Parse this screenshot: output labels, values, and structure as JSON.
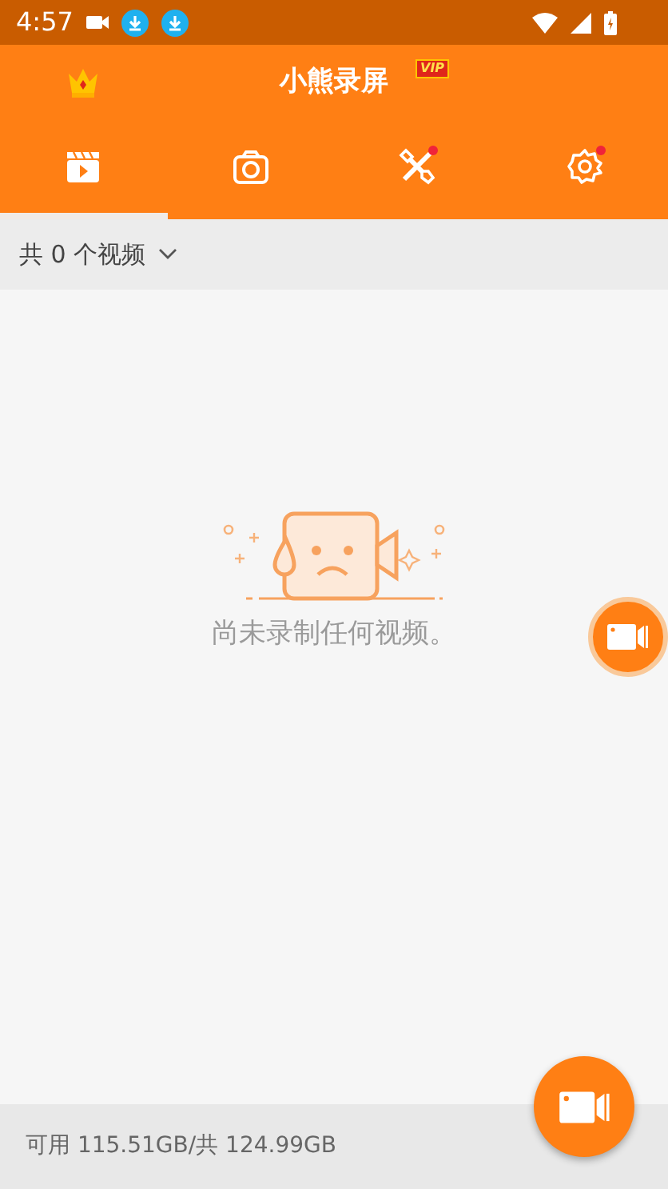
{
  "status_bar": {
    "time": "4:57"
  },
  "header": {
    "title": "小熊录屏",
    "vip_badge": "VIP"
  },
  "tabs": [
    {
      "kind": "videos",
      "selected": true,
      "badge": false
    },
    {
      "kind": "screenshots",
      "selected": false,
      "badge": false
    },
    {
      "kind": "tools",
      "selected": false,
      "badge": true
    },
    {
      "kind": "settings",
      "selected": false,
      "badge": true
    }
  ],
  "filter": {
    "label": "共 0 个视频"
  },
  "empty_state": {
    "message": "尚未录制任何视频。"
  },
  "footer": {
    "storage": "可用 115.51GB/共 124.99GB"
  }
}
